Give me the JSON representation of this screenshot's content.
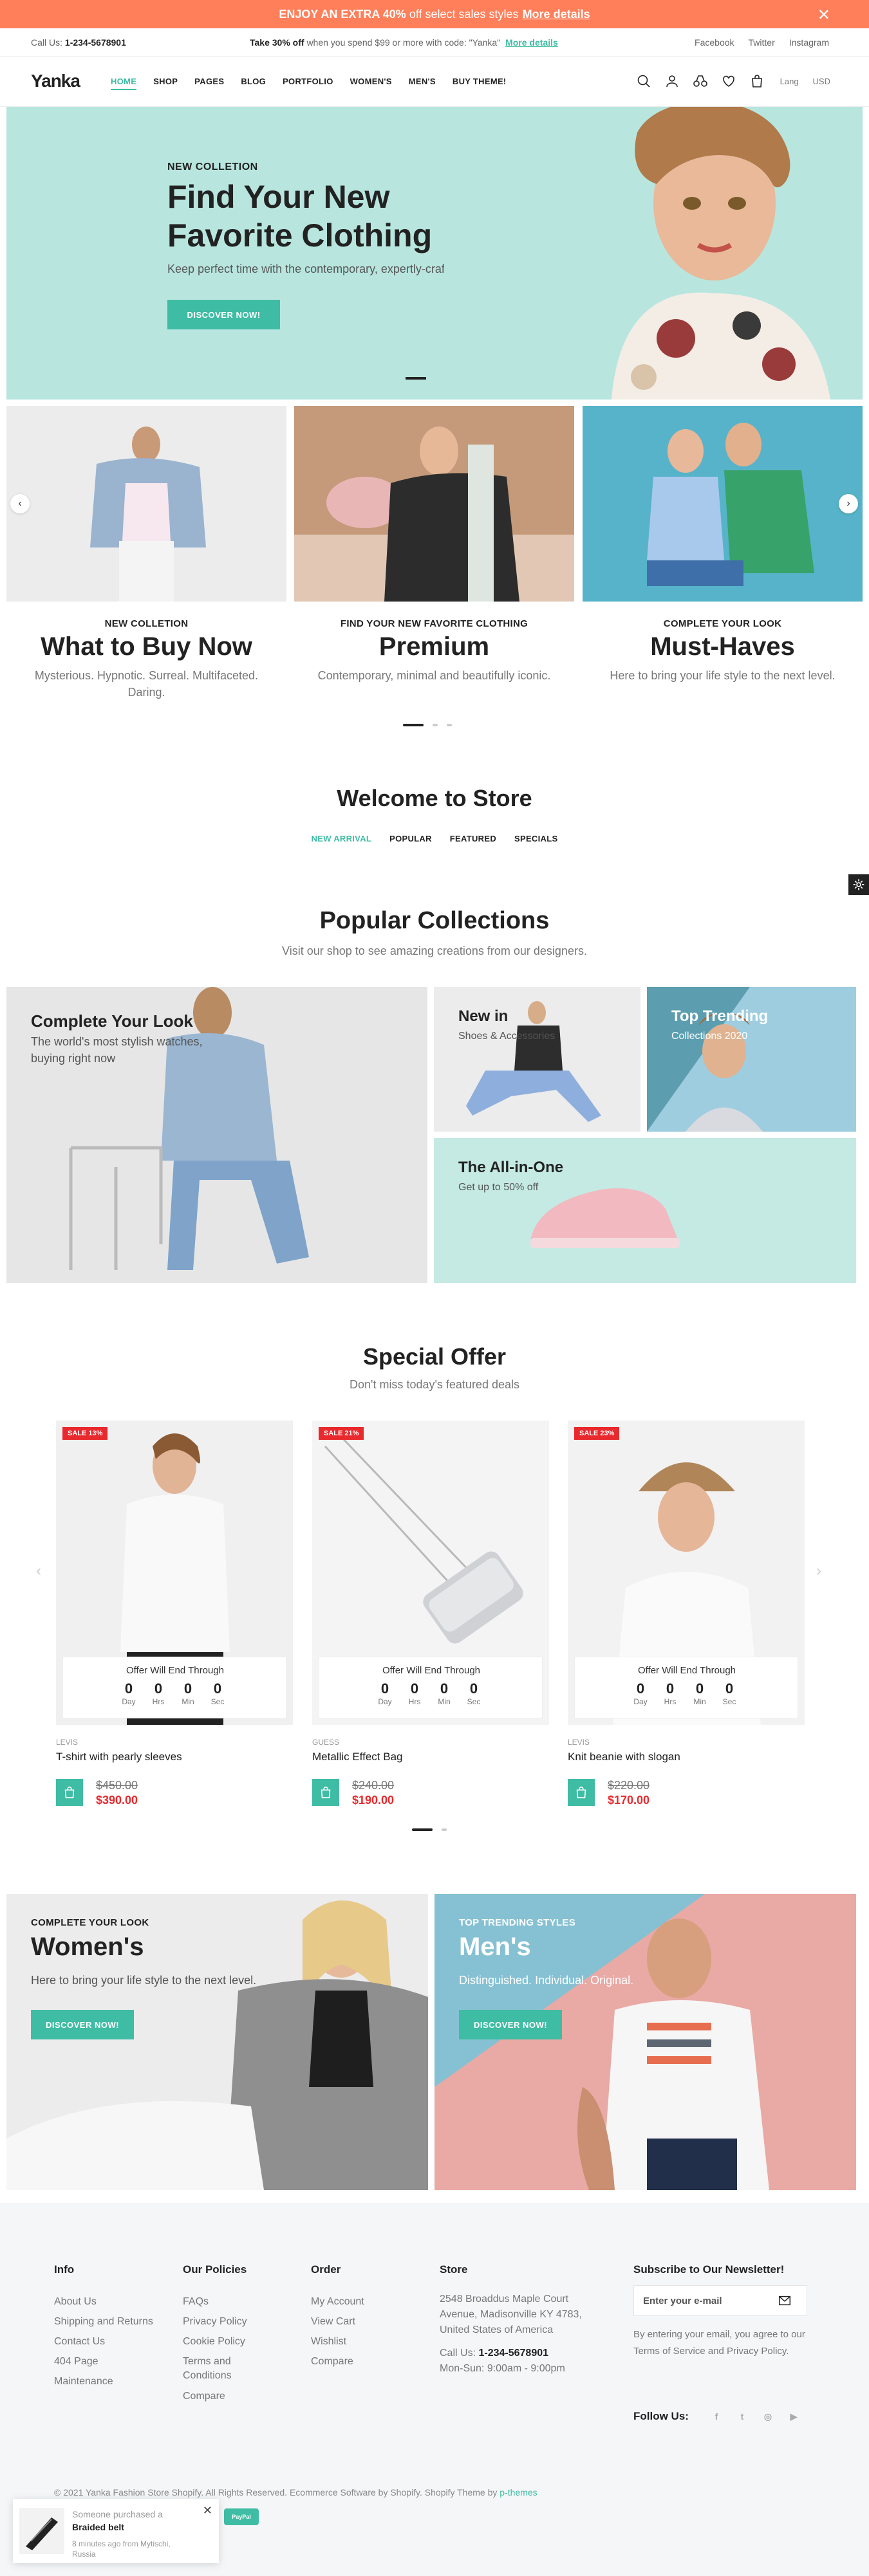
{
  "promo": {
    "text_bold": "ENJOY AN EXTRA 40%",
    "text": "off select sales styles",
    "link": "More details",
    "close": "✕"
  },
  "topbar": {
    "call_label": "Call Us:",
    "phone": "1-234-5678901",
    "offer_bold": "Take 30% off",
    "offer_text": "when you spend $99 or more with code: \"Yanka\"",
    "offer_link": "More details",
    "social": [
      "Facebook",
      "Twitter",
      "Instagram"
    ]
  },
  "header": {
    "logo": "Yanka",
    "nav": [
      "HOME",
      "SHOP",
      "PAGES",
      "BLOG",
      "PORTFOLIO",
      "WOMEN'S",
      "MEN'S",
      "BUY THEME!"
    ],
    "lang": "Lang",
    "currency": "USD"
  },
  "hero": {
    "subtitle": "NEW COLLETION",
    "title": "Find Your New Favorite Clothing",
    "description": "Keep perfect time with the contemporary, expertly-crafted designs.",
    "button": "DISCOVER NOW!"
  },
  "slides": [
    {
      "kicker": "NEW COLLETION",
      "title": "What to Buy Now",
      "text": "Mysterious. Hypnotic. Surreal. Multifaceted. Daring."
    },
    {
      "kicker": "FIND YOUR NEW FAVORITE CLOTHING",
      "title": "Premium",
      "text": "Contemporary, minimal and beautifully iconic."
    },
    {
      "kicker": "COMPLETE YOUR LOOK",
      "title": "Must-Haves",
      "text": "Here to bring your life style to the next level."
    }
  ],
  "welcome": {
    "title": "Welcome to Store",
    "tabs": [
      "NEW ARRIVAL",
      "POPULAR",
      "FEATURED",
      "SPECIALS"
    ]
  },
  "collections": {
    "title": "Popular Collections",
    "subtitle": "Visit our shop to see amazing creations from our designers.",
    "cards": [
      {
        "title": "Complete Your Look",
        "desc": "The world's most stylish watches, buying right now"
      },
      {
        "title": "New in",
        "desc": "Shoes & Accessories"
      },
      {
        "title": "Top Trending",
        "desc": "Collections 2020"
      },
      {
        "title": "The All-in-One",
        "desc": "Get up to 50% off"
      }
    ]
  },
  "special": {
    "title": "Special Offer",
    "subtitle": "Don't miss today's featured deals",
    "timer_title": "Offer Will End Through",
    "timer_labels": [
      "Day",
      "Hrs",
      "Min",
      "Sec"
    ],
    "products": [
      {
        "badge": "SALE 13%",
        "vendor": "LEVIS",
        "name": "T-shirt with pearly sleeves",
        "old_price": "$450.00",
        "price": "$390.00",
        "timer": [
          "0",
          "0",
          "0",
          "0"
        ]
      },
      {
        "badge": "SALE 21%",
        "vendor": "GUESS",
        "name": "Metallic Effect Bag",
        "old_price": "$240.00",
        "price": "$190.00",
        "timer": [
          "0",
          "0",
          "0",
          "0"
        ]
      },
      {
        "badge": "SALE 23%",
        "vendor": "LEVIS",
        "name": "Knit beanie with slogan",
        "old_price": "$220.00",
        "price": "$170.00",
        "timer": [
          "0",
          "0",
          "0",
          "0"
        ]
      }
    ]
  },
  "banners": [
    {
      "kicker": "COMPLETE YOUR LOOK",
      "title": "Women's",
      "desc": "Here to bring your life style to the next level.",
      "button": "DISCOVER NOW!"
    },
    {
      "kicker": "TOP TRENDING STYLES",
      "title": "Men's",
      "desc": "Distinguished. Individual. Original.",
      "button": "DISCOVER NOW!"
    }
  ],
  "footer": {
    "info": {
      "title": "Info",
      "links": [
        "About Us",
        "Shipping and Returns",
        "Contact Us",
        "404 Page",
        "Maintenance"
      ]
    },
    "policies": {
      "title": "Our Policies",
      "links": [
        "FAQs",
        "Privacy Policy",
        "Cookie Policy",
        "Terms and Conditions",
        "Compare"
      ]
    },
    "order": {
      "title": "Order",
      "links": [
        "My Account",
        "View Cart",
        "Wishlist",
        "Compare"
      ]
    },
    "store": {
      "title": "Store",
      "address": "2548 Broaddus Maple Court Avenue, Madisonville KY 4783, United States of America",
      "call_label": "Call Us:",
      "phone": "1-234-5678901",
      "hours": "Mon-Sun: 9:00am - 9:00pm"
    },
    "subscribe": {
      "title": "Subscribe to Our Newsletter!",
      "placeholder": "Enter your e-mail",
      "note": "By entering your email, you agree to our Terms of Service and Privacy Policy."
    },
    "follow": "Follow Us:",
    "copyright": "© 2021 Yanka Fashion Store Shopify. All Rights Reserved. Ecommerce Software by Shopify. Shopify Theme by",
    "theme_author": "p-themes",
    "pay_label": "PayPal"
  },
  "toast": {
    "line1": "Someone purchased a",
    "product": "Braided belt",
    "time": "8 minutes ago from Mytischi, Russia",
    "close": "✕"
  },
  "colors": {
    "accent": "#3fbca4",
    "promo": "#ff7f5a",
    "sale": "#e8292d",
    "hero_bg": "#b8e6df"
  }
}
